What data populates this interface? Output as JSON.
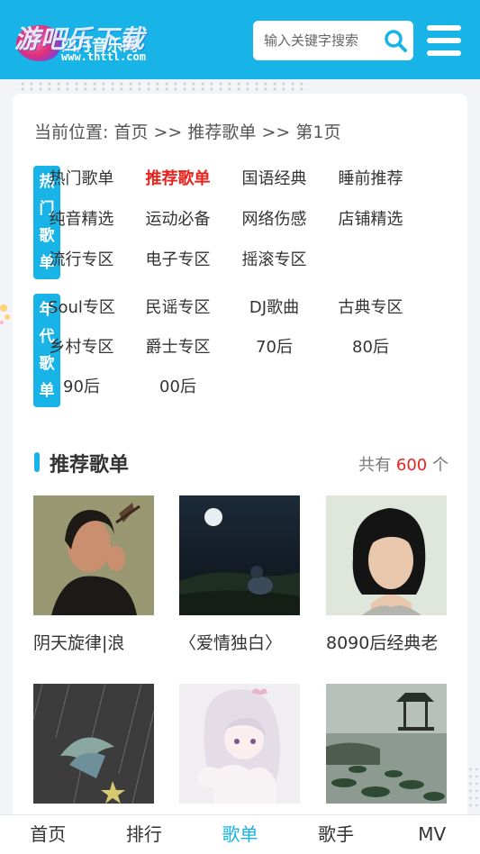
{
  "header": {
    "logo_title": "游吧乐下载",
    "logo_sub": "四月音乐网",
    "logo_url": "www.thttl.com",
    "search_placeholder": "输入关键字搜索"
  },
  "breadcrumb": {
    "prefix": "当前位置:",
    "home": "首页",
    "sep1": ">>",
    "current": "推荐歌单",
    "sep2": ">>",
    "page": "第1页"
  },
  "categories": [
    {
      "label": "热门歌单",
      "items": [
        "热门歌单",
        "推荐歌单",
        "国语经典",
        "睡前推荐",
        "纯音精选",
        "运动必备",
        "网络伤感",
        "店铺精选",
        "流行专区",
        "电子专区",
        "摇滚专区"
      ],
      "active": "推荐歌单"
    },
    {
      "label": "年代歌单",
      "items": [
        "Soul专区",
        "民谣专区",
        "DJ歌曲",
        "古典专区",
        "乡村专区",
        "爵士专区",
        "70后",
        "80后",
        "90后",
        "00后"
      ]
    }
  ],
  "section": {
    "title": "推荐歌单",
    "count_prefix": "共有",
    "count": "600",
    "count_suffix": "个"
  },
  "playlists": [
    {
      "name": "阴天旋律|浪",
      "image": "woman-with-feather-photo"
    },
    {
      "name": "〈爱情独白〉",
      "image": "night-moon-figure-photo"
    },
    {
      "name": "8090后经典老",
      "image": "short-hair-woman-portrait"
    },
    {
      "name": "",
      "image": "umbrella-in-rain-illustration"
    },
    {
      "name": "",
      "image": "anime-girl-bunny-illustration"
    },
    {
      "name": "",
      "image": "lake-pavilion-landscape"
    }
  ],
  "tabbar": {
    "tabs": [
      "首页",
      "排行",
      "歌单",
      "歌手",
      "MV"
    ],
    "active": "歌单"
  },
  "colors": {
    "brand": "#18b4e8",
    "highlight": "#e8241e"
  }
}
